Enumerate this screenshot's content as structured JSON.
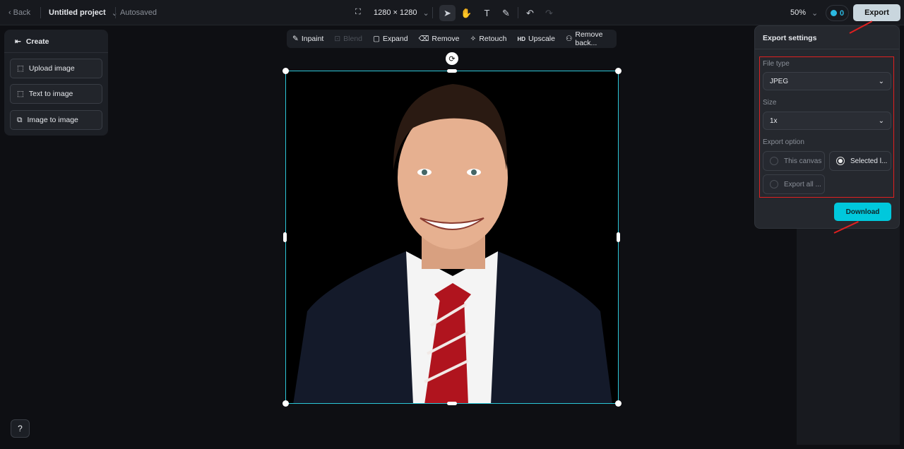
{
  "topbar": {
    "back": "Back",
    "project": "Untitled project",
    "status": "Autosaved",
    "canvas_size": "1280 × 1280",
    "zoom": "50%",
    "credits": "0",
    "export": "Export"
  },
  "create_panel": {
    "title": "Create",
    "items": [
      "Upload image",
      "Text to image",
      "Image to image"
    ]
  },
  "image_tools": [
    {
      "label": "Inpaint",
      "icon": "inpaint-icon",
      "disabled": false
    },
    {
      "label": "Blend",
      "icon": "blend-icon",
      "disabled": true
    },
    {
      "label": "Expand",
      "icon": "expand-icon",
      "disabled": false
    },
    {
      "label": "Remove",
      "icon": "eraser-icon",
      "disabled": false
    },
    {
      "label": "Retouch",
      "icon": "retouch-icon",
      "disabled": false
    },
    {
      "label": "Upscale",
      "icon": "hd-icon",
      "disabled": false
    },
    {
      "label": "Remove back...",
      "icon": "person-icon",
      "disabled": false
    }
  ],
  "hd_badge": "HD",
  "export_settings": {
    "title": "Export settings",
    "file_type_label": "File type",
    "file_type": "JPEG",
    "size_label": "Size",
    "size": "1x",
    "export_option_label": "Export option",
    "options": [
      {
        "label": "This canvas",
        "selected": false
      },
      {
        "label": "Selected l...",
        "selected": true
      },
      {
        "label": "Export all ...",
        "selected": false
      }
    ],
    "download": "Download"
  },
  "colors": {
    "accent": "#00c8dc",
    "selection": "#2bc6d6",
    "annotation": "#e02020"
  }
}
